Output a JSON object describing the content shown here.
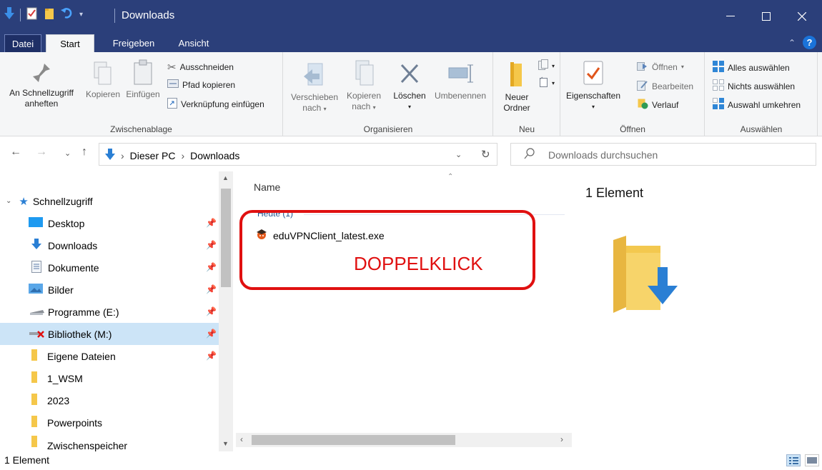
{
  "window": {
    "title": "Downloads",
    "controls": [
      "minimize",
      "maximize",
      "close"
    ]
  },
  "ribbon_tabs": [
    {
      "label": "Datei"
    },
    {
      "label": "Start"
    },
    {
      "label": "Freigeben"
    },
    {
      "label": "Ansicht"
    }
  ],
  "ribbon": {
    "clipboard": {
      "pin_label_1": "An Schnellzugriff",
      "pin_label_2": "anheften",
      "copy": "Kopieren",
      "paste": "Einfügen",
      "cut": "Ausschneiden",
      "copy_path": "Pfad kopieren",
      "paste_shortcut": "Verknüpfung einfügen",
      "group": "Zwischenablage"
    },
    "organize": {
      "move_1": "Verschieben",
      "move_2": "nach",
      "copyto_1": "Kopieren",
      "copyto_2": "nach",
      "delete": "Löschen",
      "rename": "Umbenennen",
      "group": "Organisieren"
    },
    "new": {
      "folder_1": "Neuer",
      "folder_2": "Ordner",
      "group": "Neu"
    },
    "open": {
      "properties": "Eigenschaften",
      "open": "Öffnen",
      "edit": "Bearbeiten",
      "history": "Verlauf",
      "group": "Öffnen"
    },
    "select": {
      "all": "Alles auswählen",
      "none": "Nichts auswählen",
      "invert": "Auswahl umkehren",
      "group": "Auswählen"
    }
  },
  "address": {
    "crumbs": [
      "Dieser PC",
      "Downloads"
    ],
    "search_placeholder": "Downloads durchsuchen"
  },
  "sidebar": {
    "quick_access": "Schnellzugriff",
    "items": [
      {
        "label": "Desktop",
        "pinned": true
      },
      {
        "label": "Downloads",
        "pinned": true
      },
      {
        "label": "Dokumente",
        "pinned": true
      },
      {
        "label": "Bilder",
        "pinned": true
      },
      {
        "label": "Programme (E:)",
        "pinned": true
      },
      {
        "label": "Bibliothek (M:)",
        "pinned": true,
        "selected": true
      },
      {
        "label": "Eigene Dateien",
        "pinned": true
      },
      {
        "label": "1_WSM",
        "pinned": false
      },
      {
        "label": "2023",
        "pinned": false
      },
      {
        "label": "Powerpoints",
        "pinned": false
      },
      {
        "label": "Zwischenspeicher",
        "pinned": false
      }
    ]
  },
  "main": {
    "column_name": "Name",
    "group_heading": "Heute (1)",
    "files": [
      {
        "name": "eduVPNClient_latest.exe"
      }
    ],
    "annotation": "DOPPELKLICK"
  },
  "preview": {
    "count": "1 Element"
  },
  "status": {
    "text": "1 Element"
  },
  "colors": {
    "titlebar": "#2b3f7a",
    "annotation_red": "#e01010",
    "selection": "#cce4f7",
    "folder_yellow": "#f5c74a",
    "arrow_blue": "#2a7fd4"
  }
}
